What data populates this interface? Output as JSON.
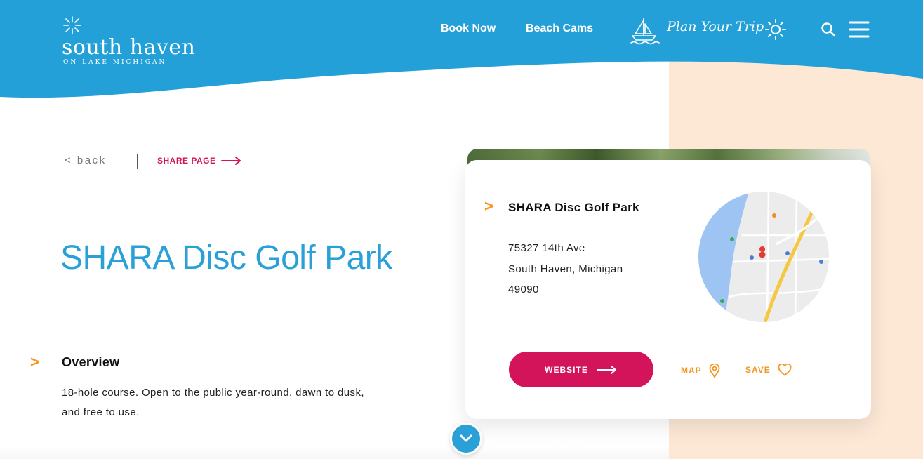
{
  "colors": {
    "brand_blue": "#2aa0d8",
    "accent_pink": "#d3145a",
    "accent_orange": "#f7941d",
    "peach": "#fde8d6"
  },
  "header": {
    "logo_title": "south haven",
    "logo_subtitle": "ON LAKE MICHIGAN",
    "nav": {
      "book_now": "Book Now",
      "beach_cams": "Beach Cams",
      "plan_your_trip": "Plan Your Trip"
    },
    "icons": [
      "sailboat-icon",
      "sun-icon",
      "search-icon",
      "menu-icon"
    ]
  },
  "breadcrumb": {
    "back_label": "< back",
    "share_label": "SHARE PAGE"
  },
  "page": {
    "title": "SHARA Disc Golf Park",
    "overview_heading": "Overview",
    "overview_text": "18-hole course. Open to the public year-round, dawn to dusk, and free to use."
  },
  "listing": {
    "name": "SHARA Disc Golf Park",
    "address_line1": "75327 14th Ave",
    "address_line2": "South Haven, Michigan",
    "address_line3": "49090",
    "website_label": "WEBSITE",
    "map_label": "MAP",
    "save_label": "SAVE"
  }
}
